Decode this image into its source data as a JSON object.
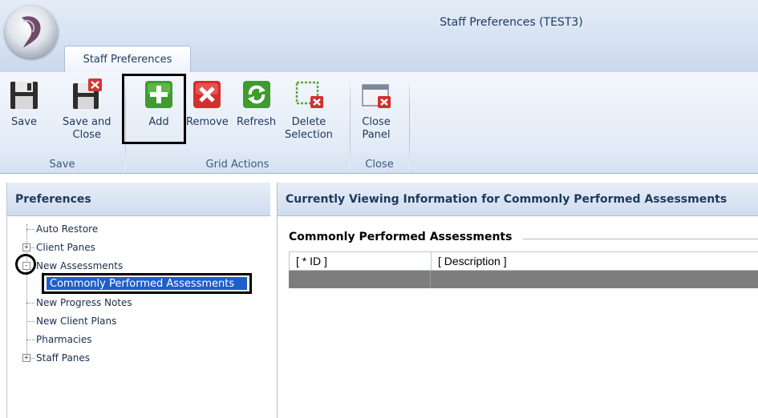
{
  "window": {
    "title": "Staff Preferences (TEST3)"
  },
  "tabs": [
    {
      "label": "Staff Preferences",
      "active": true
    }
  ],
  "ribbon": {
    "groups": [
      {
        "label": "Save",
        "buttons": [
          {
            "label": "Save",
            "icon": "floppy-disk-icon"
          },
          {
            "label": "Save and\nClose",
            "icon": "floppy-disk-close-icon"
          }
        ]
      },
      {
        "label": "Grid Actions",
        "buttons": [
          {
            "label": "Add",
            "icon": "green-plus-icon"
          },
          {
            "label": "Remove",
            "icon": "red-x-icon"
          },
          {
            "label": "Refresh",
            "icon": "green-refresh-icon"
          },
          {
            "label": "Delete\nSelection",
            "icon": "delete-selection-icon"
          }
        ]
      },
      {
        "label": "Close",
        "buttons": [
          {
            "label": "Close\nPanel",
            "icon": "close-panel-icon"
          }
        ]
      }
    ]
  },
  "preferences": {
    "header": "Preferences",
    "tree": [
      {
        "label": "Auto Restore",
        "expander": ""
      },
      {
        "label": "Client Panes",
        "expander": "+"
      },
      {
        "label": "New Assessments",
        "expander": "-"
      },
      {
        "label": "Commonly Performed Assessments",
        "expander": "",
        "selected": true
      },
      {
        "label": "New Progress Notes",
        "expander": ""
      },
      {
        "label": "New Client Plans",
        "expander": ""
      },
      {
        "label": "Pharmacies",
        "expander": ""
      },
      {
        "label": "Staff Panes",
        "expander": "+"
      }
    ]
  },
  "content": {
    "header": "Currently Viewing Information for Commonly Performed Assessments",
    "group_caption": "Commonly Performed Assessments",
    "grid": {
      "columns": [
        "[ * ID ]",
        "[ Description ]"
      ],
      "rows": [
        [
          "",
          ""
        ]
      ]
    }
  },
  "colors": {
    "selection": "#1e5fc8",
    "grid_row": "#7d7d7d",
    "accent_text": "#1e395b"
  }
}
